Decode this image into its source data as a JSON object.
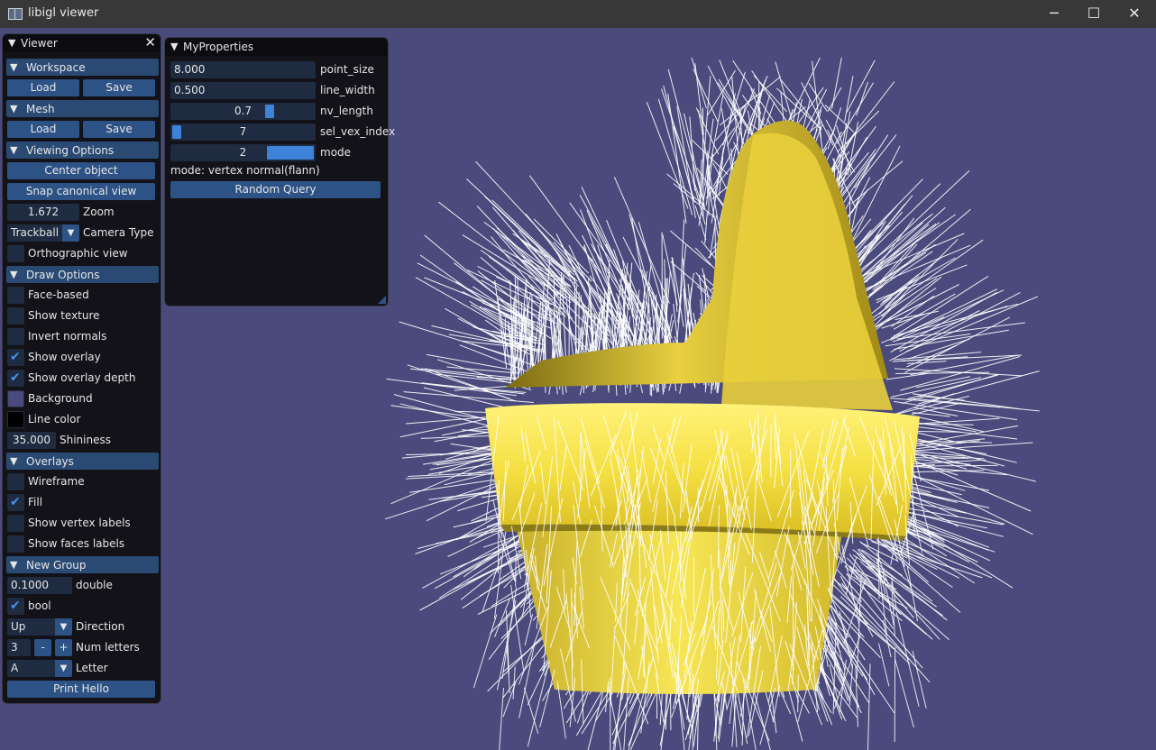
{
  "window": {
    "title": "libigl viewer",
    "minimize": "─",
    "maximize": "☐",
    "close": "✕"
  },
  "viewer": {
    "title": "Viewer",
    "close_glyph": "✕",
    "arrow": "▼",
    "workspace": {
      "label": "Workspace",
      "load": "Load",
      "save": "Save"
    },
    "mesh": {
      "label": "Mesh",
      "load": "Load",
      "save": "Save"
    },
    "viewing": {
      "label": "Viewing Options",
      "center": "Center object",
      "snap": "Snap canonical view",
      "zoom_value": "1.672",
      "zoom_label": "Zoom",
      "camera_value": "Trackball",
      "camera_label": "Camera Type",
      "ortho_label": "Orthographic view"
    },
    "draw": {
      "label": "Draw Options",
      "face_based": "Face-based",
      "show_texture": "Show texture",
      "invert_normals": "Invert normals",
      "show_overlay": "Show overlay",
      "show_overlay_depth": "Show overlay depth",
      "background": "Background",
      "line_color": "Line color",
      "shininess_value": "35.000",
      "shininess_label": "Shininess"
    },
    "overlays": {
      "label": "Overlays",
      "wireframe": "Wireframe",
      "fill": "Fill",
      "vertex_labels": "Show vertex labels",
      "faces_labels": "Show faces labels"
    },
    "new_group": {
      "label": "New Group",
      "double_value": "0.1000",
      "double_label": "double",
      "bool_label": "bool",
      "direction_value": "Up",
      "direction_label": "Direction",
      "num_value": "3",
      "minus": "-",
      "plus": "+",
      "num_label": "Num letters",
      "letter_value": "A",
      "letter_label": "Letter",
      "print": "Print Hello"
    },
    "checks": {
      "ortho": false,
      "face_based": false,
      "show_texture": false,
      "invert_normals": false,
      "show_overlay": true,
      "show_overlay_depth": true,
      "wireframe": false,
      "fill": true,
      "vertex_labels": false,
      "faces_labels": false,
      "bool": true
    },
    "check_glyph": "✔",
    "combo_glyph": "▼"
  },
  "props": {
    "title": "MyProperties",
    "point_size_value": "8.000",
    "point_size_label": "point_size",
    "line_width_value": "0.500",
    "line_width_label": "line_width",
    "nv_length_value": "0.7",
    "nv_length_label": "nv_length",
    "nv_length_fraction": 0.7,
    "sel_vex_value": "7",
    "sel_vex_label": "sel_vex_index",
    "sel_vex_fraction": 0.0,
    "mode_value": "2",
    "mode_label": "mode",
    "mode_fraction": 1.0,
    "mode_text": "mode: vertex normal(flann)",
    "random_query": "Random Query"
  },
  "colors": {
    "background": "#4a4a7d",
    "line_color": "#000000",
    "mesh": "#f2e04a",
    "normals": "#ffffff",
    "accent": "#3d83d8"
  }
}
